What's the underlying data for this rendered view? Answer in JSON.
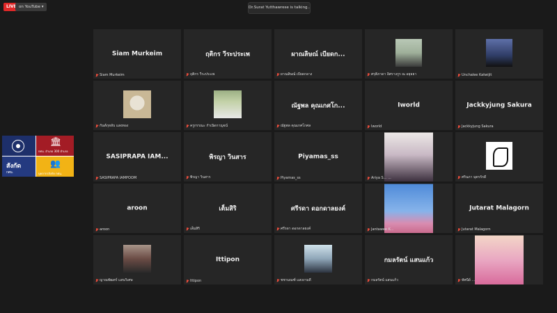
{
  "top": {
    "live_label": "LIVE",
    "youtube_label": "on YouTube ▾",
    "talking": "Dr.Surat Yutthawrese is talking..."
  },
  "share": {
    "bank_sub": "กศน. อำเภอ 300 อำเภอ",
    "head": "สังกัด",
    "small": "กศน.",
    "people_sub": "บุคลากรสังกัด กศน."
  },
  "tiles": [
    {
      "name": "Siam Murkeim",
      "label": "Siam Murkeim"
    },
    {
      "name": "ฤติกร  วีระประเพ",
      "label": "ฤติกร วีระประเพ"
    },
    {
      "name": "ผาณลิษณ์  เบียดก...",
      "label": "ผาณลิษณ์ เบียดกลาง"
    },
    {
      "name": "",
      "label": "ศรุติภาดา อิศรางกูร ณ อยุธยา"
    },
    {
      "name": "",
      "label": "Unchalee Katwijit"
    },
    {
      "name": "",
      "label": "กันต์กุหลับ แสงทอง"
    },
    {
      "name": "",
      "label": "ครูกรรณะ กำเนิดกาญจน์"
    },
    {
      "name": "ณัฐพล คุณเกศโก...",
      "label": "ณัฐพล คุณเกศโกศล"
    },
    {
      "name": "Iworld",
      "label": "Iworld"
    },
    {
      "name": "Jackkyjung Sakura",
      "label": "Jackkyjung Sakura"
    },
    {
      "name": "SASIPRAPA  IAM...",
      "label": "SASIPRAPA IAMPOOM"
    },
    {
      "name": "พิรญา  วินสาร",
      "label": "พิรญา วินสาร"
    },
    {
      "name": "Piyamas_ss",
      "label": "Piyamas_ss"
    },
    {
      "name": "",
      "label": "Ariya S... ..."
    },
    {
      "name": "",
      "label": "ศรินภา มุตรรักดี"
    },
    {
      "name": "aroon",
      "label": "aroon"
    },
    {
      "name": "เต็มสิริ",
      "label": "เต็มสิริ"
    },
    {
      "name": "ศรีรดา  ดอกดาลยงค์",
      "label": "ศรีรดา ดอกดาลยงค์"
    },
    {
      "name": "",
      "label": "Jantawee K..."
    },
    {
      "name": "Jutarat Malagorn",
      "label": "Jutarat Malagorn"
    },
    {
      "name": "",
      "label": "ญาณพัฒตร์ แสนวิเศษ"
    },
    {
      "name": "Ittipon",
      "label": "Ittipon"
    },
    {
      "name": "",
      "label": "ชชามณฑ์ แสงงามดี"
    },
    {
      "name": "กมลรัตน์  แสนแก้ว",
      "label": "กมลรัตน์ แสนแก้ว"
    },
    {
      "name": "",
      "label": "ทัศนีย์ ..."
    }
  ]
}
